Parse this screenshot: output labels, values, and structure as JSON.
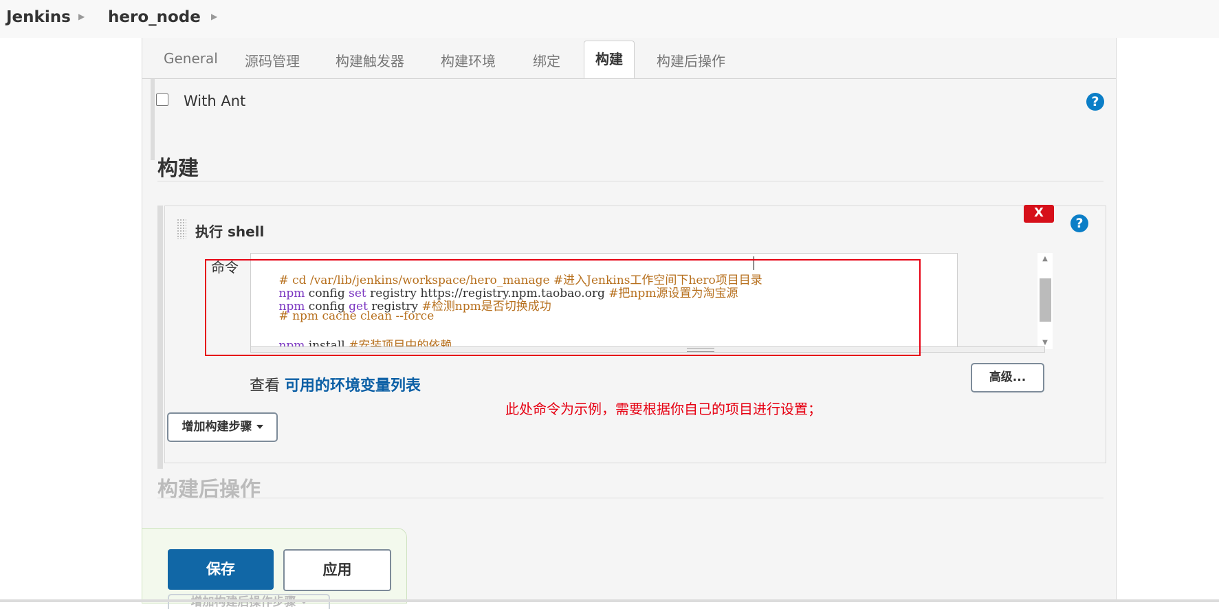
{
  "breadcrumb": {
    "home": "Jenkins",
    "project": "hero_node"
  },
  "tabs": [
    {
      "label": "General"
    },
    {
      "label": "源码管理"
    },
    {
      "label": "构建触发器"
    },
    {
      "label": "构建环境"
    },
    {
      "label": "绑定"
    },
    {
      "label": "构建"
    },
    {
      "label": "构建后操作"
    }
  ],
  "active_tab": "构建",
  "with_ant": {
    "label": "With Ant",
    "checked": false
  },
  "build": {
    "title": "构建",
    "step": {
      "title": "执行 shell",
      "delete_label": "X",
      "command_label": "命令",
      "command_lines": [
        {
          "text": "# cd /var/lib/jenkins/workspace/hero_manage #进入Jenkins工作空间下hero项目目录"
        },
        {
          "kw": "npm",
          "plain": " config ",
          "kw2": "set",
          "plain2": " registry https://registry.npm.taobao.org ",
          "comment": "#把npm源设置为淘宝源"
        },
        {
          "kw": "npm",
          "plain": " config ",
          "kw2": "get",
          "plain2": " registry ",
          "comment": "#检测npm是否切换成功"
        },
        {
          "text": "# npm cache clean --force"
        },
        {
          "text": ""
        },
        {
          "kw": "npm",
          "plain": " install ",
          "comment": "#安装项目中的依赖"
        }
      ],
      "env_prefix": "查看",
      "env_link": "可用的环境变量列表",
      "note": "此处命令为示例，需要根据你自己的项目进行设置；",
      "advanced_label": "高级..."
    },
    "add_step_label": "增加构建步骤"
  },
  "post_build": {
    "title": "构建后操作",
    "add_label": "增加构建后操作步骤"
  },
  "actions": {
    "save_label": "保存",
    "apply_label": "应用"
  },
  "colors": {
    "accent_blue": "#1167a6",
    "link_blue": "#0b5fa5",
    "help_blue": "#0b7ec7",
    "delete_red": "#d6101a",
    "annotation_red": "#e60012",
    "keyword_purple": "#7b36c1",
    "comment_orange": "#b7701e"
  },
  "icons": {
    "breadcrumb_separator": "chevron-right-icon",
    "help": "question-circle-icon",
    "drag": "drag-handle-icon",
    "dropdown": "caret-down-icon"
  }
}
